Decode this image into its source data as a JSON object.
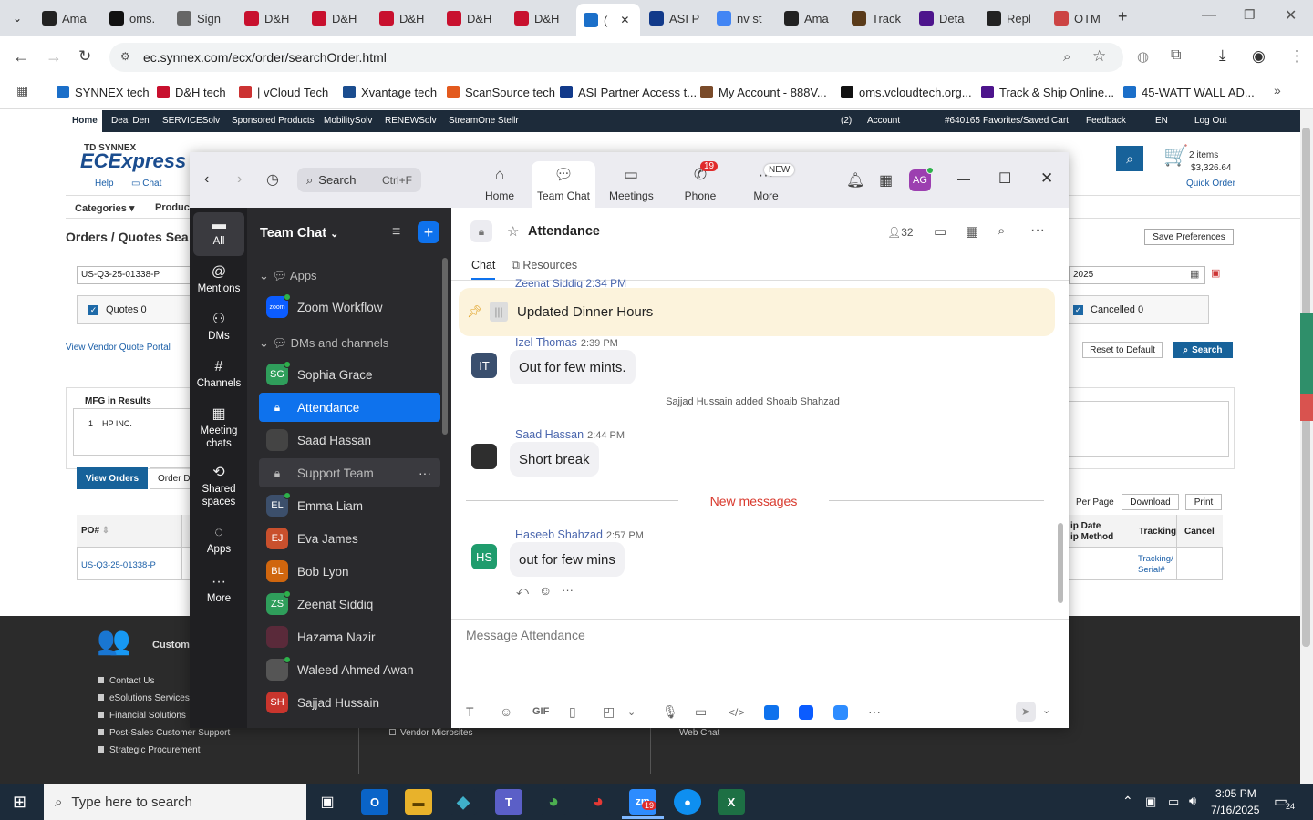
{
  "browser": {
    "tabs": [
      {
        "label": "Ama",
        "icon": "amazon-icon"
      },
      {
        "label": "oms.",
        "icon": "vcloud-icon"
      },
      {
        "label": "Sign",
        "icon": "globe-icon"
      },
      {
        "label": "D&H",
        "icon": "dh-icon"
      },
      {
        "label": "D&H",
        "icon": "dh-icon"
      },
      {
        "label": "D&H",
        "icon": "dh-icon"
      },
      {
        "label": "D&H",
        "icon": "dh-icon"
      },
      {
        "label": "D&H",
        "icon": "dh-icon"
      },
      {
        "label": "(",
        "icon": "ec-icon"
      },
      {
        "label": "ASI P",
        "icon": "asi-icon"
      },
      {
        "label": "nv st",
        "icon": "google-icon"
      },
      {
        "label": "Ama",
        "icon": "amazon-icon"
      },
      {
        "label": "Track",
        "icon": "ups-icon"
      },
      {
        "label": "Deta",
        "icon": "fedex-icon"
      },
      {
        "label": "Repl",
        "icon": "openai-icon"
      },
      {
        "label": "OTM",
        "icon": "otm-icon"
      }
    ],
    "url": "ec.synnex.com/ecx/order/searchOrder.html",
    "bookmarks": [
      "SYNNEX tech",
      "D&H tech",
      "| vCloud Tech",
      "Xvantage tech",
      "ScanSource tech",
      "ASI Partner Access t...",
      "My Account - 888V...",
      "oms.vcloudtech.org...",
      "Track & Ship Online...",
      "45-WATT WALL AD..."
    ]
  },
  "site": {
    "nav": [
      "Home",
      "Deal Den",
      "SERVICESolv",
      "Sponsored Products",
      "MobilitySolv",
      "RENEWSolv",
      "StreamOne Stellr"
    ],
    "nav_right": [
      "(2)",
      "Account",
      "#640165",
      "Favorites/Saved Cart",
      "Feedback",
      "EN",
      "Log Out"
    ],
    "logo_top": "TD SYNNEX",
    "logo": "ECExpress",
    "help": "Help",
    "chat": "Chat",
    "categories": "Categories",
    "products": "Produc",
    "cart_items": "2 items",
    "cart_total": "$3,326.64",
    "quick_order": "Quick Order",
    "page_title": "Orders / Quotes Sea",
    "search_value": "US-Q3-25-01338-P",
    "date_value": "2025",
    "save_prefs": "Save Preferences",
    "quotes": "Quotes 0",
    "cancelled": "Cancelled 0",
    "vendor_portal": "View Vendor Quote Portal",
    "reset": "Reset to Default",
    "search_btn": "Search",
    "mfg_title": "MFG in Results",
    "mfg_item": "1    HP INC.",
    "view_orders": "View Orders",
    "order_d": "Order D",
    "per_page": "Per Page",
    "download": "Download",
    "print": "Print",
    "col_po": "PO#",
    "col_shipdate": "ip Date",
    "col_shipmethod": "ip Method",
    "col_tracking": "Tracking",
    "col_cancel": "Cancel",
    "row_po": "US-Q3-25-01338-P",
    "row_tracking": "Tracking/ Serial#",
    "footer_title": "Custome",
    "footer_links": [
      "Contact Us",
      "eSolutions Services",
      "Financial Solutions",
      "Post-Sales Customer Support",
      "Strategic Procurement"
    ],
    "footer_mid": "Vendor Microsites",
    "footer_right": "Web Chat"
  },
  "zoom": {
    "search_placeholder": "Search",
    "search_shortcut": "Ctrl+F",
    "nav": [
      {
        "label": "Home",
        "icon": "home-icon"
      },
      {
        "label": "Team Chat",
        "icon": "chat-icon"
      },
      {
        "label": "Meetings",
        "icon": "video-icon"
      },
      {
        "label": "Phone",
        "icon": "phone-icon",
        "badge": "19"
      },
      {
        "label": "More",
        "icon": "more-icon",
        "badge": "NEW"
      }
    ],
    "avatar": "AG",
    "rail": [
      {
        "label": "All",
        "icon": "chat-bubble-icon"
      },
      {
        "label": "Mentions",
        "icon": "at-icon"
      },
      {
        "label": "DMs",
        "icon": "people-icon"
      },
      {
        "label": "Channels",
        "icon": "hash-icon"
      },
      {
        "label": "Meeting chats",
        "icon": "calendar-icon"
      },
      {
        "label": "Shared spaces",
        "icon": "share-icon"
      },
      {
        "label": "Apps",
        "icon": "apps-icon"
      },
      {
        "label": "More",
        "icon": "ellipsis-icon"
      }
    ],
    "list_title": "Team Chat",
    "sections": {
      "apps": "Apps",
      "dms": "DMs and channels"
    },
    "items": [
      {
        "name": "Zoom Workflow",
        "initials": "zoom",
        "color": "#0b5cff"
      },
      {
        "name": "Sophia Grace",
        "initials": "SG",
        "color": "#2f9e5b"
      },
      {
        "name": "Attendance",
        "initials": "",
        "color": "#1f6feb"
      },
      {
        "name": "Saad Hassan",
        "initials": "",
        "color": "#444"
      },
      {
        "name": "Support Team",
        "initials": "",
        "color": "#444"
      },
      {
        "name": "Emma Liam",
        "initials": "EL",
        "color": "#3c4f6b"
      },
      {
        "name": "Eva James",
        "initials": "EJ",
        "color": "#c9502d"
      },
      {
        "name": "Bob Lyon",
        "initials": "BL",
        "color": "#d0660e"
      },
      {
        "name": "Zeenat Siddiq",
        "initials": "ZS",
        "color": "#2f9e5b"
      },
      {
        "name": "Hazama Nazir",
        "initials": "",
        "color": "#5a2a3a"
      },
      {
        "name": "Waleed Ahmed Awan",
        "initials": "",
        "color": "#555"
      },
      {
        "name": "Sajjad Hussain",
        "initials": "SH",
        "color": "#c9352d"
      }
    ],
    "channel": {
      "title": "Attendance",
      "members": "32",
      "tab_chat": "Chat",
      "tab_resources": "Resources"
    },
    "messages": {
      "cut_header": "Zeenat Siddiq 2:34 PM",
      "pinned": "Updated Dinner Hours",
      "m1_name": "Izel Thomas",
      "m1_time": "2:39 PM",
      "m1_initials": "IT",
      "m1_text": "Out for few mints.",
      "system": "Sajjad Hussain added Shoaib Shahzad",
      "m2_name": "Saad Hassan",
      "m2_time": "2:44 PM",
      "m2_text": "Short break",
      "new_messages": "New messages",
      "m3_name": "Haseeb Shahzad",
      "m3_time": "2:57 PM",
      "m3_initials": "HS",
      "m3_text": "out for few mins"
    },
    "composer_placeholder": "Message Attendance",
    "gif": "GIF"
  },
  "taskbar": {
    "search_placeholder": "Type here to search",
    "time": "3:05 PM",
    "date": "7/16/2025",
    "zoom_badge": "19",
    "notif_count": "24"
  }
}
